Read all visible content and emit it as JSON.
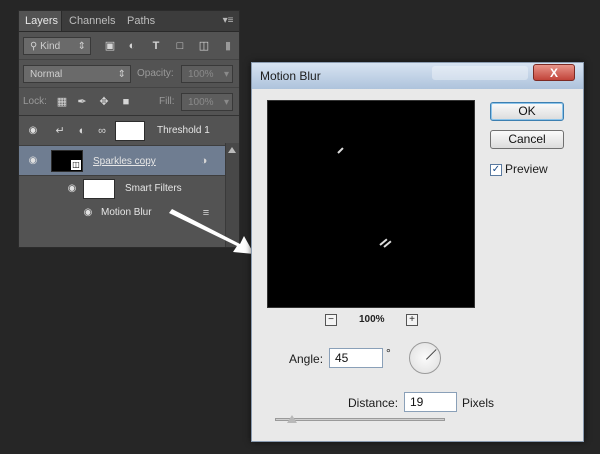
{
  "layers_panel": {
    "tabs": [
      "Layers",
      "Channels",
      "Paths"
    ],
    "filter": {
      "kind_label": "Kind"
    },
    "blend_mode": "Normal",
    "opacity_label": "Opacity:",
    "opacity_value": "100%",
    "lock_label": "Lock:",
    "fill_label": "Fill:",
    "fill_value": "100%",
    "layers": [
      {
        "name": "Threshold 1",
        "type": "adjustment",
        "selected": false
      },
      {
        "name": "Sparkles copy",
        "type": "smart-object",
        "selected": true
      },
      {
        "name": "Smart Filters",
        "type": "smart-filters",
        "selected": false
      },
      {
        "name": "Motion Blur",
        "type": "filter",
        "selected": false
      }
    ]
  },
  "dialog": {
    "title": "Motion Blur",
    "ok_label": "OK",
    "cancel_label": "Cancel",
    "preview_label": "Preview",
    "preview_checked": true,
    "zoom_level": "100%",
    "zoom_out_icon": "minus",
    "zoom_in_icon": "plus",
    "angle_label": "Angle:",
    "angle_value": "45",
    "angle_unit": "°",
    "distance_label": "Distance:",
    "distance_value": "19",
    "distance_unit": "Pixels",
    "close_glyph": "X"
  },
  "colors": {
    "panel_bg": "#535353",
    "selected_layer": "#6f7d91",
    "dialog_bg": "#e9e9e9",
    "close_button": "#c1443a"
  }
}
